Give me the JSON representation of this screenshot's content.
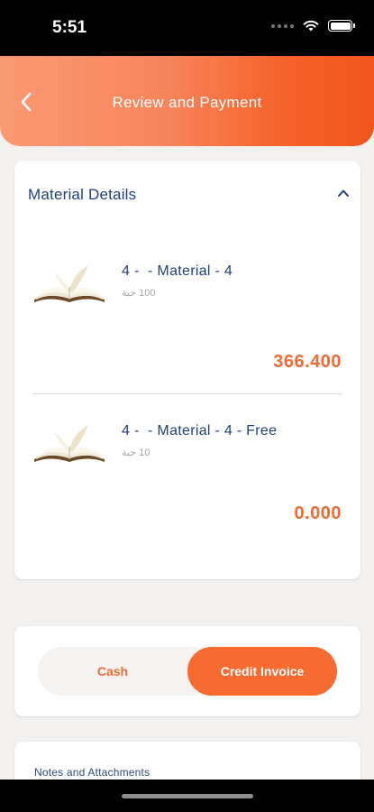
{
  "status_bar": {
    "time": "5:51",
    "icons": [
      "signal-dots-icon",
      "wifi-icon",
      "battery-icon"
    ]
  },
  "header": {
    "title": "Review and Payment",
    "back_icon": "chevron-left-icon"
  },
  "materials": {
    "section_title": "Material Details",
    "toggle_icon": "chevron-up-icon",
    "items": [
      {
        "name": "4 -  - Material - 4",
        "quantity": "100 حبة",
        "price": "366.400",
        "image_icon": "open-book-icon"
      },
      {
        "name": "4 -  - Material - 4 - Free",
        "quantity": "10 حبة",
        "price": "0.000",
        "image_icon": "open-book-icon"
      }
    ]
  },
  "payment": {
    "options": [
      "Cash",
      "Credit Invoice"
    ],
    "selected": "Credit Invoice"
  },
  "notes": {
    "label": "Notes and Attachments"
  },
  "colors": {
    "accent": "#f26a32",
    "header_gradient_start": "#f99a72",
    "header_gradient_end": "#f1561c",
    "title_blue": "#1f3f7d",
    "background": "#f3f1f0"
  }
}
